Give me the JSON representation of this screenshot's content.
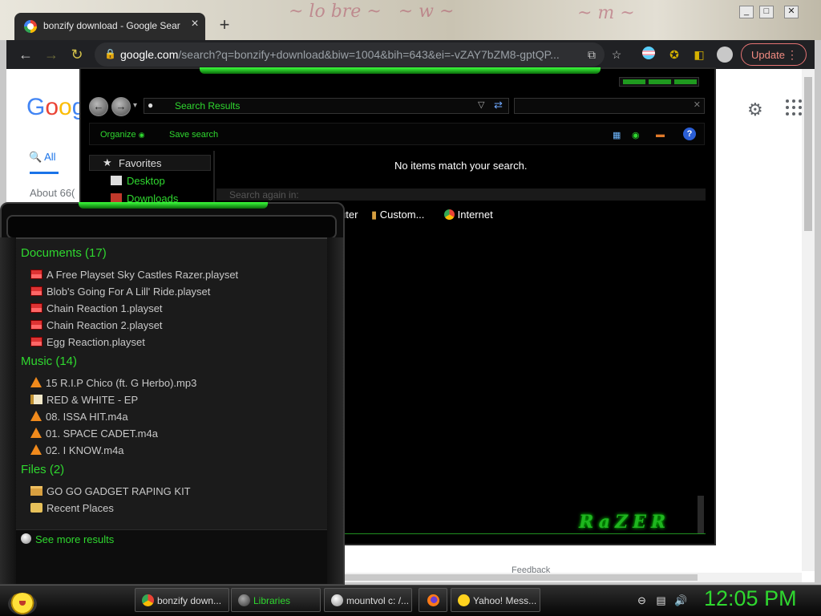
{
  "browser": {
    "tab_title": "bonzify download - Google Sear",
    "tab_close": "×",
    "new_tab": "+",
    "window_buttons": [
      "_",
      "□",
      "✕"
    ],
    "url_host": "google.com",
    "url_rest": "/search?q=bonzify+download&biw=1004&bih=643&ei=-vZAY7bZM8-gptQP...",
    "update_label": "Update"
  },
  "google": {
    "logo_text": "Goog",
    "logo_colors": [
      "#4285f4",
      "#ea4335",
      "#fbbc05",
      "#4285f4"
    ],
    "tab_all": "All",
    "about": "About 66(",
    "feedback": "Feedback"
  },
  "explorer": {
    "breadcrumb": "Search Results",
    "cmd_organize": "Organize",
    "cmd_save_search": "Save search",
    "help": "?",
    "nav": {
      "favorites": "Favorites",
      "items": [
        "Desktop",
        "Downloads"
      ]
    },
    "no_items": "No items match your search.",
    "search_again": "Search again in:",
    "locations": [
      "uter",
      "Custom...",
      "Internet"
    ],
    "brand_logo": "RaZER"
  },
  "start_menu": {
    "categories": [
      {
        "title": "Documents (17)",
        "items": [
          "A Free Playset Sky Castles Razer.playset",
          "Blob's Going For A Lill' Ride.playset",
          "Chain Reaction 1.playset",
          "Chain Reaction 2.playset",
          "Egg Reaction.playset"
        ]
      },
      {
        "title": "Music (14)",
        "items": [
          "15 R.I.P Chico (ft. G Herbo).mp3",
          "RED & WHITE - EP",
          "08. ISSA HIT.m4a",
          "01. SPACE CADET.m4a",
          "02. I KNOW.m4a"
        ]
      },
      {
        "title": "Files (2)",
        "items": [
          "GO GO GADGET RAPING KIT",
          "Recent Places"
        ]
      }
    ],
    "see_more": "See more results"
  },
  "taskbar": {
    "buttons": [
      {
        "label": "bonzify down...",
        "icon": "chrome-icon"
      },
      {
        "label": "Libraries",
        "icon": "libraries-icon"
      },
      {
        "label": "mountvol c: /...",
        "icon": "cmd-icon"
      },
      {
        "label": "",
        "icon": "firefox-icon"
      },
      {
        "label": "Yahoo! Mess...",
        "icon": "yahoo-messenger-icon"
      }
    ],
    "clock": "12:05 PM"
  },
  "colors": {
    "accent_green": "#2fd82f",
    "chrome_dark": "#202124",
    "update_red": "#f28b82"
  }
}
